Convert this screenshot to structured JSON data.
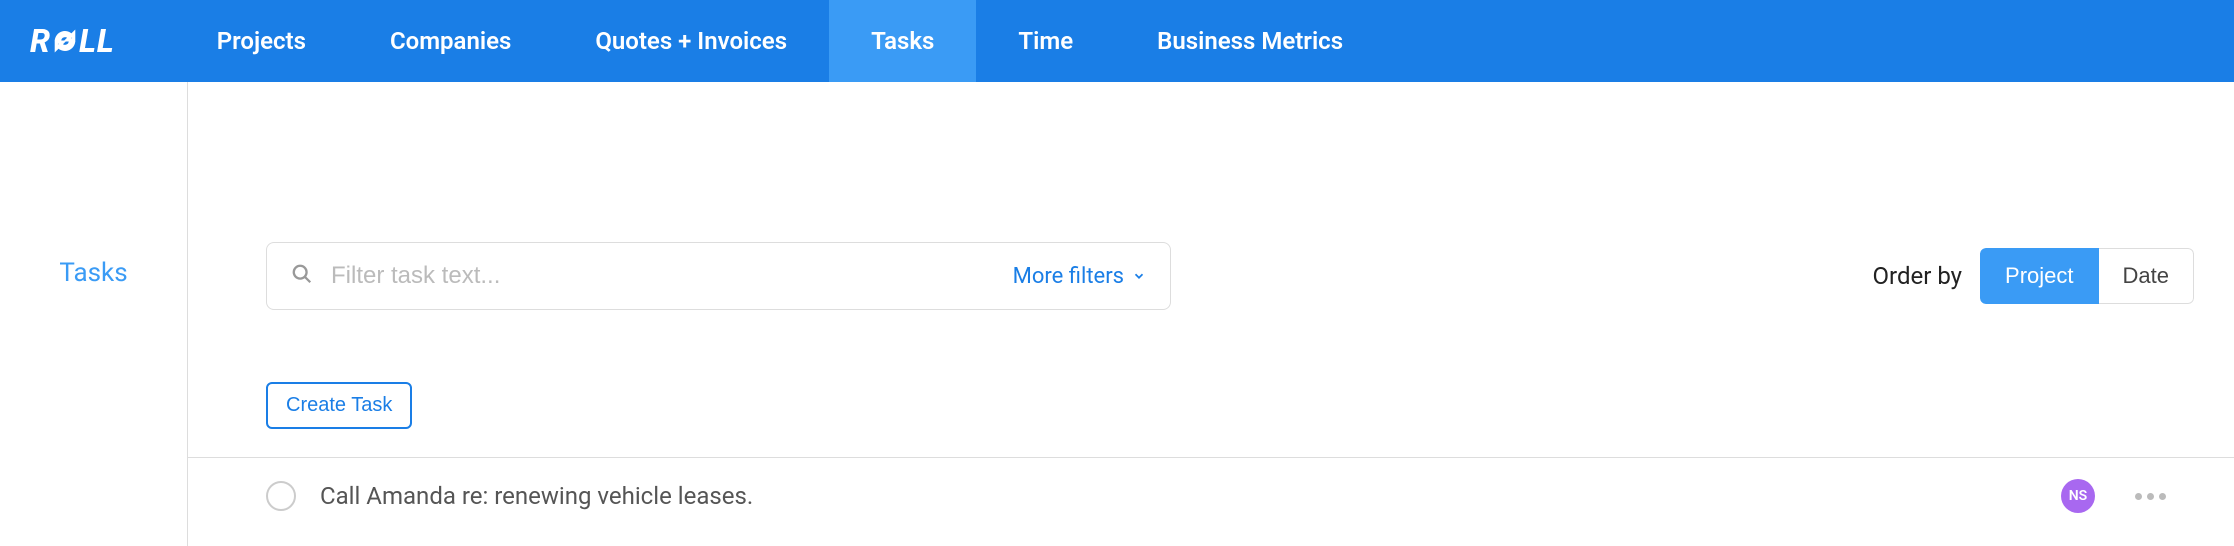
{
  "brand": {
    "name": "ROLL"
  },
  "nav": {
    "items": [
      {
        "label": "Projects",
        "active": false
      },
      {
        "label": "Companies",
        "active": false
      },
      {
        "label": "Quotes + Invoices",
        "active": false
      },
      {
        "label": "Tasks",
        "active": true
      },
      {
        "label": "Time",
        "active": false
      },
      {
        "label": "Business Metrics",
        "active": false
      }
    ]
  },
  "sidebar": {
    "title": "Tasks"
  },
  "filter": {
    "placeholder": "Filter task text...",
    "more_filters_label": "More filters"
  },
  "order": {
    "label": "Order by",
    "options": [
      {
        "label": "Project",
        "active": true
      },
      {
        "label": "Date",
        "active": false
      }
    ]
  },
  "create_task_label": "Create Task",
  "tasks": [
    {
      "text": "Call Amanda re: renewing vehicle leases.",
      "assignee_initials": "NS",
      "completed": false
    }
  ],
  "colors": {
    "primary": "#1a7ee6",
    "primary_light": "#3a9bf5",
    "avatar": "#a868f0"
  }
}
